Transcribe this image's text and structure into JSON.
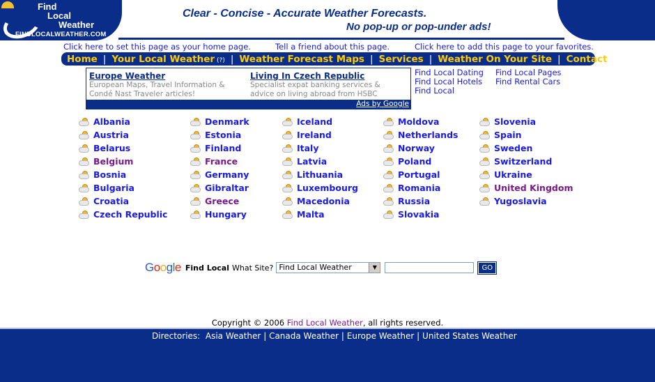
{
  "header": {
    "logo": {
      "line1": "Find",
      "line2": "Local",
      "line3": "Weather",
      "url": "FINDLOCALWEATHER.COM"
    },
    "tagline1": "Clear - Concise - Accurate Weather Forecasts.",
    "tagline2": "No pop-up or pop-under ads!"
  },
  "toplinks": {
    "home": "Click here to set this page as your home page.",
    "friend": "Tell a friend about this page.",
    "favorites": "Click here to add this page to your favorites."
  },
  "nav": {
    "home": "Home",
    "local": "Your Local Weather",
    "local_help": "(?)",
    "maps": "Weather Forecast Maps",
    "services": "Services",
    "site": "Weather On Your Site",
    "contact": "Contact",
    "sep": "|"
  },
  "ads": {
    "ad1": {
      "title": "Europe Weather",
      "line1": "European Maps, Travel Information &",
      "line2": "Condé Nast Traveler articles!"
    },
    "ad2": {
      "title": "Living In Czech Republic",
      "line1": "Specialist expat banking services &",
      "line2": "advice on living abroad from HSBC"
    },
    "adsby": "Ads by Google"
  },
  "side_links": {
    "col1": [
      "Find Local Dating",
      "Find Local Hotels",
      "Find Local"
    ],
    "col2": [
      "Find Local Pages",
      "Find Rental Cars"
    ]
  },
  "countries": {
    "col1": [
      "Albania",
      "Austria",
      "Belarus",
      "Belgium",
      "Bosnia",
      "Bulgaria",
      "Croatia",
      "Czech Republic"
    ],
    "col2": [
      "Denmark",
      "Estonia",
      "Finland",
      "France",
      "Germany",
      "Gibraltar",
      "Greece",
      "Hungary"
    ],
    "col3": [
      "Iceland",
      "Ireland",
      "Italy",
      "Latvia",
      "Lithuania",
      "Luxembourg",
      "Macedonia",
      "Malta"
    ],
    "col4": [
      "Moldova",
      "Netherlands",
      "Norway",
      "Poland",
      "Portugal",
      "Romania",
      "Russia",
      "Slovakia"
    ],
    "col5": [
      "Slovenia",
      "Spain",
      "Sweden",
      "Switzerland",
      "Ukraine",
      "United Kingdom",
      "Yugoslavia"
    ]
  },
  "search": {
    "logo_letters": [
      "G",
      "o",
      "o",
      "g",
      "l",
      "e"
    ],
    "label": "Find Local",
    "what": "What Site?",
    "select_value": "Find Local Weather",
    "input_value": "",
    "go": "GO"
  },
  "footer": {
    "copyright_pre": "Copyright © 2006",
    "copyright_link": "Find Local Weather",
    "copyright_post": ", all rights reserved.",
    "directories_label": "Directories:",
    "directories": [
      "Asia Weather",
      "Canada Weather",
      "Europe Weather",
      "United States Weather"
    ],
    "sep": "|"
  },
  "colors": {
    "brand": "#0b2d8a",
    "nav_text": "#ffcc00",
    "link": "#1a1ae6",
    "visited": "#7a1a8a"
  }
}
